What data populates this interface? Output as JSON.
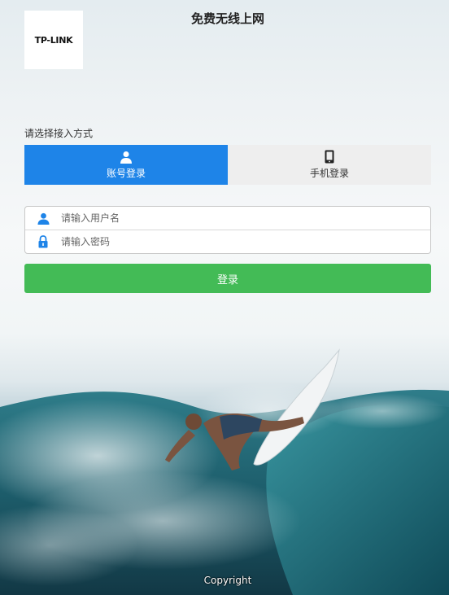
{
  "header": {
    "logo_text": "TP-LINK",
    "title": "免费无线上网"
  },
  "login": {
    "method_label": "请选择接入方式",
    "tabs": [
      {
        "label": "账号登录",
        "icon": "user-icon",
        "active": true
      },
      {
        "label": "手机登录",
        "icon": "mobile-phone-icon",
        "active": false
      }
    ],
    "username": {
      "placeholder": "请输入用户名",
      "value": "",
      "icon": "user-icon"
    },
    "password": {
      "placeholder": "请输入密码",
      "value": "",
      "icon": "lock-icon"
    },
    "submit_label": "登录"
  },
  "footer": {
    "copyright": "Copyright"
  },
  "colors": {
    "accent_blue": "#1e84e8",
    "tab_inactive": "#eeeeee",
    "login_green": "#43bb56"
  },
  "background": {
    "description_icon": "surfer-wave-photo"
  }
}
